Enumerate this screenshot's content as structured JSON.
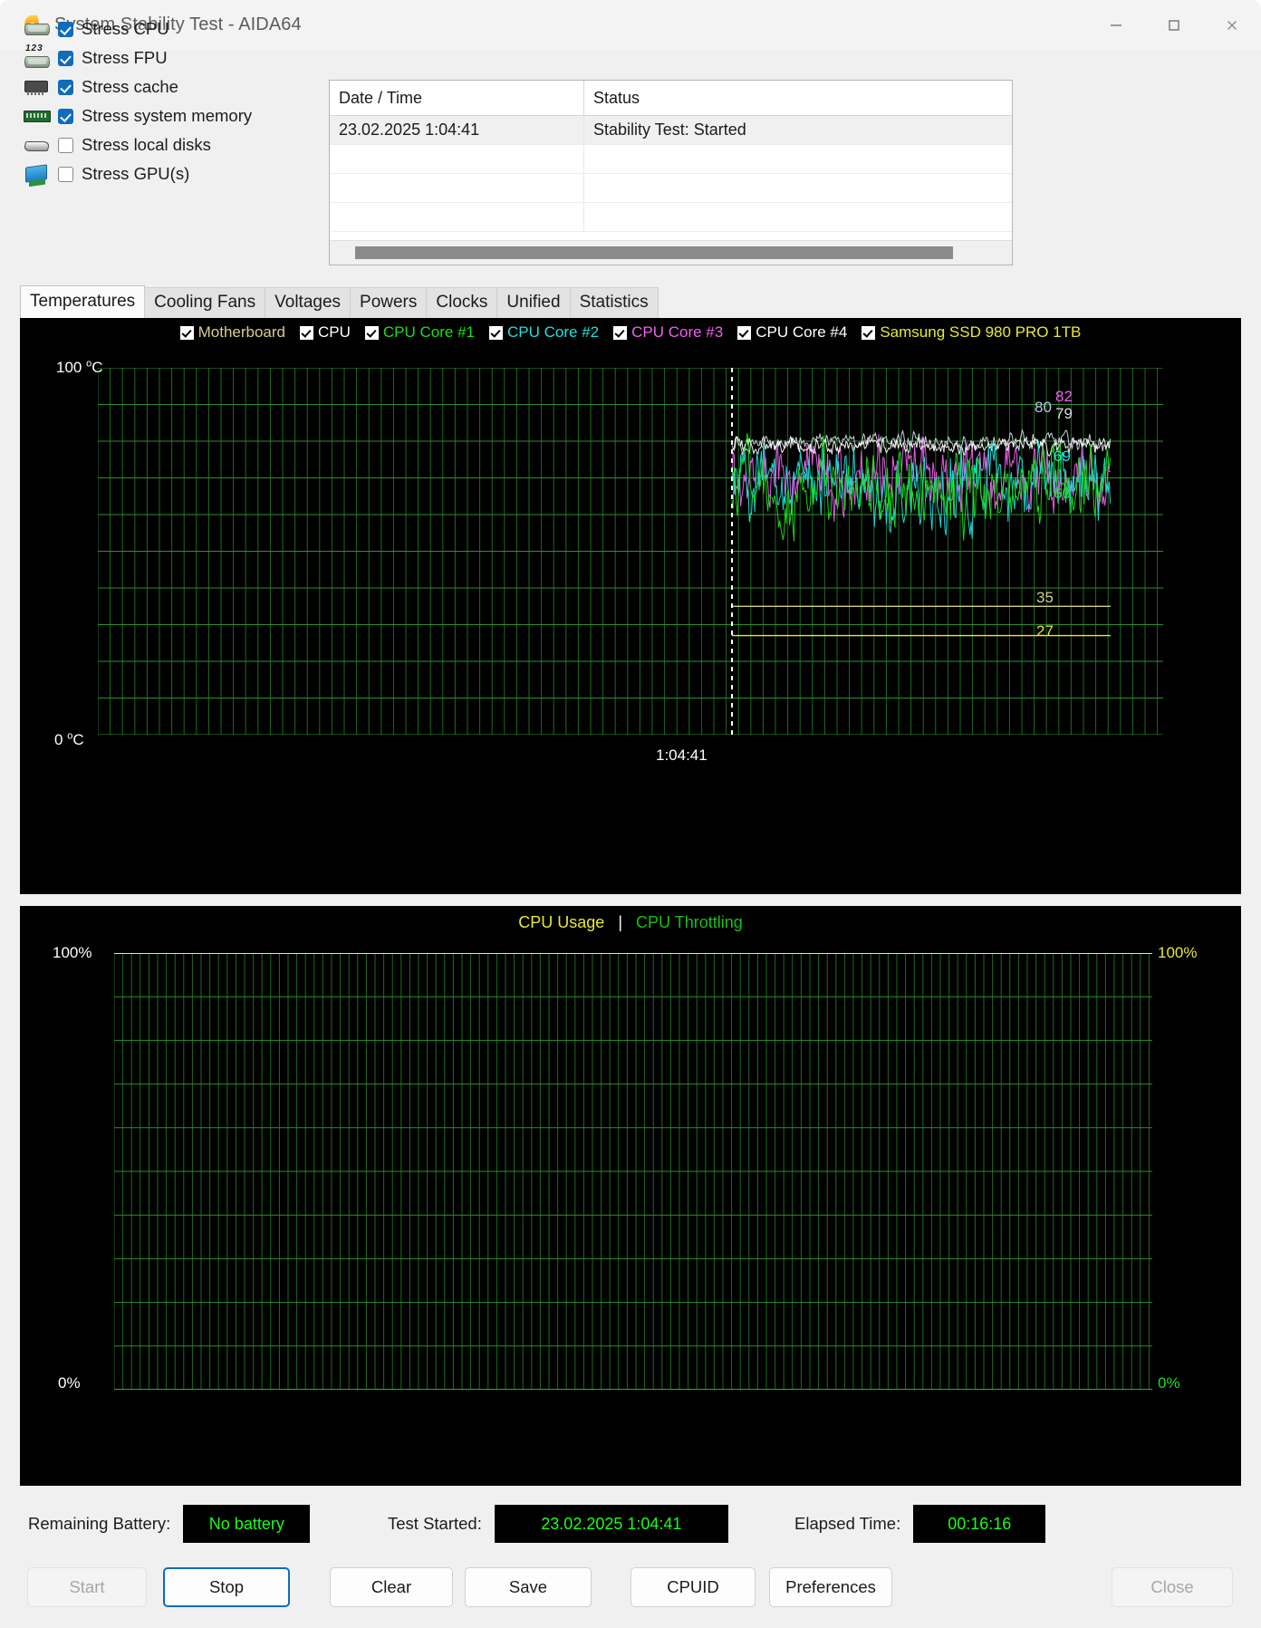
{
  "window": {
    "title": "System Stability Test - AIDA64",
    "app_icon": "flame-icon",
    "minimize": "minimize-icon",
    "maximize": "maximize-icon",
    "close": "close-icon"
  },
  "stress_options": [
    {
      "label": "Stress CPU",
      "checked": true,
      "icon": "cpu-chip-icon"
    },
    {
      "label": "Stress FPU",
      "checked": true,
      "icon": "fpu-chip-icon"
    },
    {
      "label": "Stress cache",
      "checked": true,
      "icon": "cache-chip-icon"
    },
    {
      "label": "Stress system memory",
      "checked": true,
      "icon": "memory-module-icon"
    },
    {
      "label": "Stress local disks",
      "checked": false,
      "icon": "hard-disk-icon"
    },
    {
      "label": "Stress GPU(s)",
      "checked": false,
      "icon": "gpu-monitor-icon"
    }
  ],
  "log": {
    "columns": [
      "Date / Time",
      "Status"
    ],
    "rows": [
      {
        "datetime": "23.02.2025 1:04:41",
        "status": "Stability Test: Started"
      },
      {
        "datetime": "",
        "status": ""
      },
      {
        "datetime": "",
        "status": ""
      },
      {
        "datetime": "",
        "status": ""
      }
    ]
  },
  "tabs": [
    {
      "label": "Temperatures",
      "active": true
    },
    {
      "label": "Cooling Fans",
      "active": false
    },
    {
      "label": "Voltages",
      "active": false
    },
    {
      "label": "Powers",
      "active": false
    },
    {
      "label": "Clocks",
      "active": false
    },
    {
      "label": "Unified",
      "active": false
    },
    {
      "label": "Statistics",
      "active": false
    }
  ],
  "temperature_legend": [
    {
      "label": "Motherboard",
      "color": "#d6cf8a",
      "checked": true
    },
    {
      "label": "CPU",
      "color": "#ffffff",
      "checked": true
    },
    {
      "label": "CPU Core #1",
      "color": "#18e018",
      "checked": true
    },
    {
      "label": "CPU Core #2",
      "color": "#20e0e0",
      "checked": true
    },
    {
      "label": "CPU Core #3",
      "color": "#f060f0",
      "checked": true
    },
    {
      "label": "CPU Core #4",
      "color": "#ffffff",
      "checked": true
    },
    {
      "label": "Samsung SSD 980 PRO 1TB",
      "color": "#e8e83a",
      "checked": true
    }
  ],
  "chart_data": [
    {
      "type": "line",
      "name": "temperature-chart",
      "title": "",
      "ylabel_top": "100 °C",
      "ylabel_bottom": "0 °C",
      "ylim": [
        0,
        100
      ],
      "grid": true,
      "xaxis_marker_label": "1:04:41",
      "series": [
        {
          "name": "CPU Core #3",
          "color": "#f060f0",
          "current": 82,
          "mean": 70,
          "noise": 13,
          "style": "noisy"
        },
        {
          "name": "CPU",
          "color": "#d8d8e8",
          "current": 80,
          "mean": 80,
          "noise": 3,
          "style": "noisy"
        },
        {
          "name": "CPU Core #4",
          "color": "#ffffff",
          "current": 79,
          "mean": 79,
          "noise": 3,
          "style": "noisy"
        },
        {
          "name": "CPU Core #2",
          "color": "#20e0e0",
          "current": 69,
          "mean": 68,
          "noise": 13,
          "style": "noisy"
        },
        {
          "name": "CPU Core #1",
          "color": "#18e018",
          "current": 60,
          "mean": 68,
          "noise": 13,
          "style": "noisy"
        },
        {
          "name": "Motherboard",
          "color": "#d6cf8a",
          "current": 35,
          "mean": 35,
          "noise": 0,
          "style": "flat"
        },
        {
          "name": "Samsung SSD 980 PRO 1TB",
          "color": "#e8e83a",
          "current": 27,
          "mean": 27,
          "noise": 0,
          "style": "flat"
        }
      ],
      "right_value_labels": [
        {
          "value": "80",
          "color": "#b9c6f0"
        },
        {
          "value": "82",
          "color": "#f060f0"
        },
        {
          "value": "79",
          "color": "#dcdcdc"
        },
        {
          "value": "69",
          "color": "#20e0e0"
        },
        {
          "value": "60",
          "color": "#18e018"
        },
        {
          "value": "35",
          "color": "#d6cf8a"
        },
        {
          "value": "27",
          "color": "#e8e83a"
        }
      ]
    },
    {
      "type": "line",
      "name": "cpu-usage-chart",
      "title_parts": [
        {
          "text": "CPU Usage",
          "color": "#e8e83a"
        },
        {
          "text": "|",
          "color": "#ffffff"
        },
        {
          "text": "CPU Throttling",
          "color": "#18c018"
        }
      ],
      "ylabel_top_left": "100%",
      "ylabel_bottom_left": "0%",
      "ylabel_top_right": "100%",
      "ylabel_bottom_right": "0%",
      "ylim": [
        0,
        100
      ],
      "grid": true,
      "series": [
        {
          "name": "CPU Usage",
          "color": "#e8e88a",
          "value": 100,
          "style": "flat-top"
        },
        {
          "name": "CPU Throttling",
          "color": "#18c018",
          "value": 0,
          "style": "flat-bottom"
        }
      ]
    }
  ],
  "footer": {
    "battery_label": "Remaining Battery:",
    "battery_value": "No battery",
    "started_label": "Test Started:",
    "started_value": "23.02.2025 1:04:41",
    "elapsed_label": "Elapsed Time:",
    "elapsed_value": "00:16:16"
  },
  "buttons": [
    {
      "label": "Start",
      "state": "disabled"
    },
    {
      "label": "Stop",
      "state": "focused"
    },
    {
      "label": "Clear",
      "state": "normal"
    },
    {
      "label": "Save",
      "state": "normal"
    },
    {
      "label": "CPUID",
      "state": "normal"
    },
    {
      "label": "Preferences",
      "state": "normal"
    },
    {
      "label": "Close",
      "state": "disabled"
    }
  ]
}
